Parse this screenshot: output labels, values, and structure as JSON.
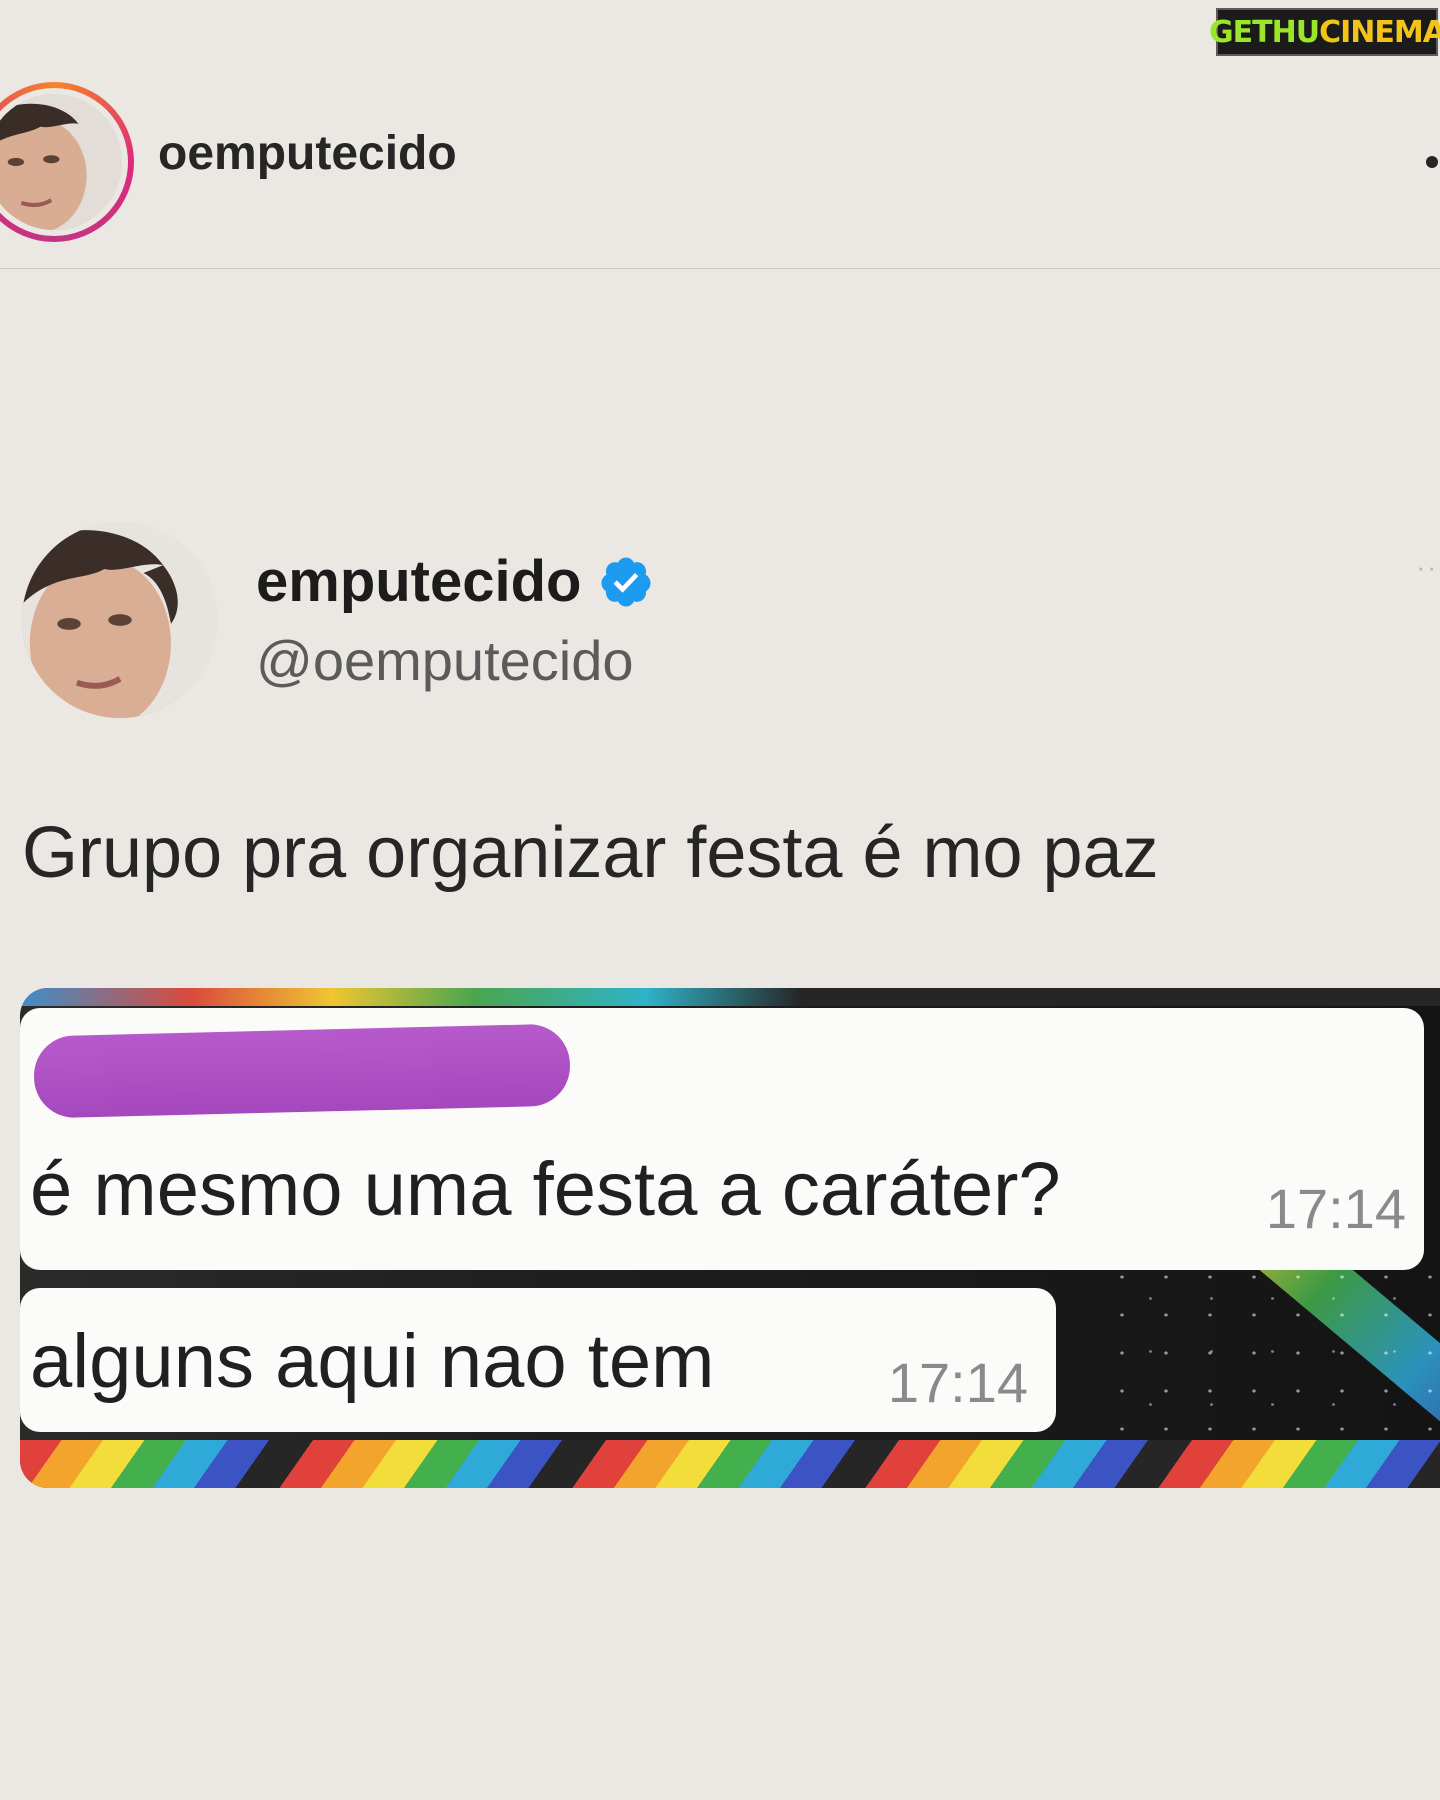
{
  "watermark": {
    "part1": "GETHU",
    "part2": "CINEMA"
  },
  "header": {
    "username": "oemputecido",
    "avatar_icon": "profile-photo",
    "more_icon": "more-dot-icon"
  },
  "tweet": {
    "display_name": "emputecido",
    "handle": "@oemputecido",
    "verified_icon": "verified-badge-icon",
    "text": "Grupo pra organizar festa é mo paz",
    "more": "··"
  },
  "chat": {
    "messages": [
      {
        "text": "é mesmo uma festa a caráter?",
        "time": "17:14",
        "sender_redacted": true
      },
      {
        "text": "alguns aqui nao tem",
        "time": "17:14",
        "sender_redacted": false
      }
    ]
  },
  "colors": {
    "background": "#ebe7e2",
    "verified_blue": "#1d9bf0",
    "redaction_purple": "#a548be",
    "story_ring": [
      "#f58529",
      "#dd2a7b",
      "#c13584"
    ]
  }
}
